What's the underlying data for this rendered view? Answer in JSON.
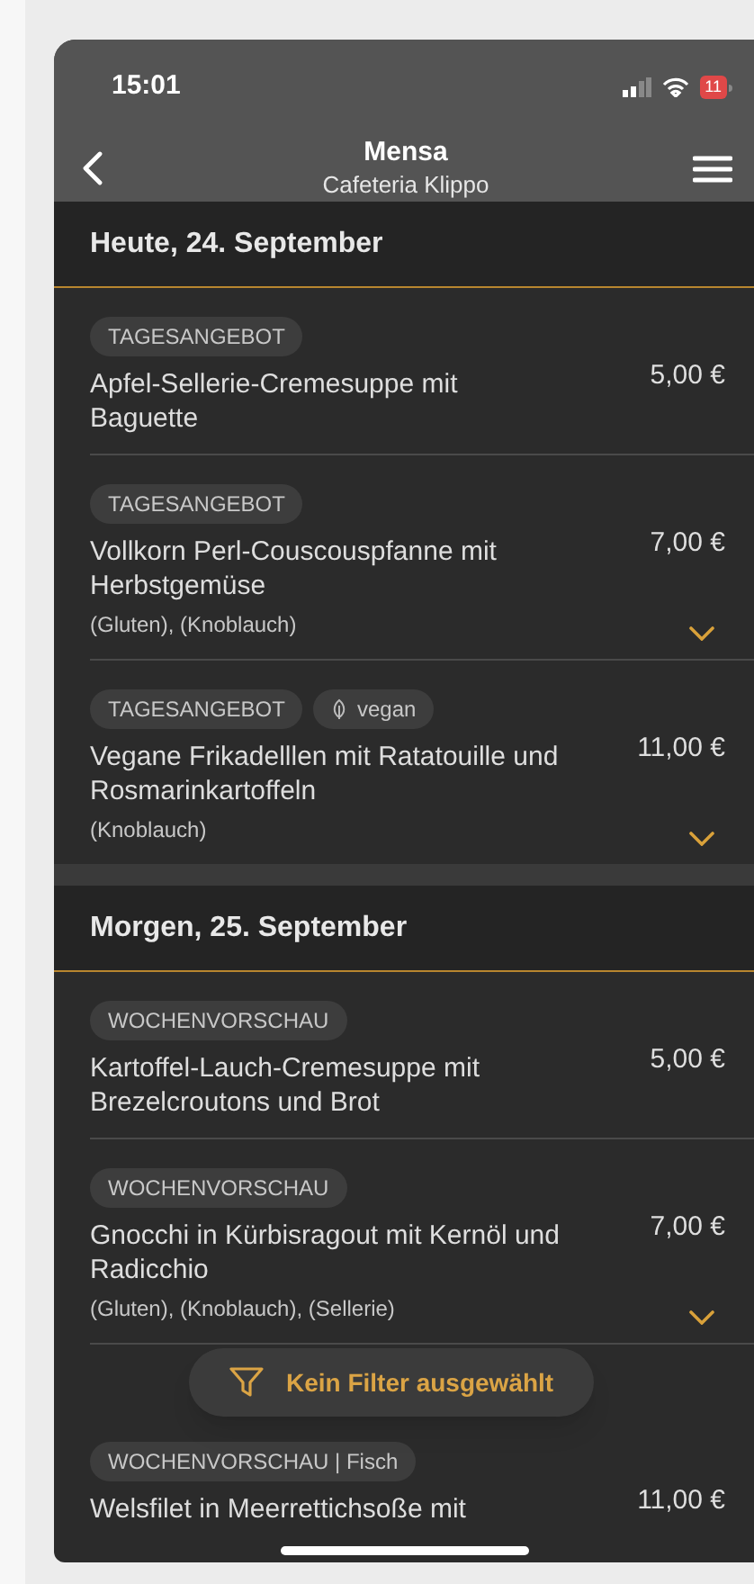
{
  "status_bar": {
    "time": "15:01",
    "battery": "11"
  },
  "nav": {
    "title": "Mensa",
    "subtitle": "Cafeteria Klippo"
  },
  "sections": [
    {
      "title": "Heute, 24. September",
      "items": [
        {
          "tags": [
            {
              "label": "TAGESANGEBOT",
              "kind": "plain"
            }
          ],
          "name": "Apfel-Sellerie-Cremesuppe mit Baguette",
          "price": "5,00 €",
          "expandable": false
        },
        {
          "tags": [
            {
              "label": "TAGESANGEBOT",
              "kind": "plain"
            }
          ],
          "name": "Vollkorn Perl-Couscouspfanne mit Herbstgemüse",
          "allergens": "(Gluten), (Knoblauch)",
          "price": "7,00 €",
          "expandable": true
        },
        {
          "tags": [
            {
              "label": "TAGESANGEBOT",
              "kind": "plain"
            },
            {
              "label": "vegan",
              "kind": "vegan"
            }
          ],
          "name": "Vegane Frikadelllen mit Ratatouille und Rosmarinkartoffeln",
          "allergens": "(Knoblauch)",
          "price": "11,00 €",
          "expandable": true
        }
      ]
    },
    {
      "title": "Morgen, 25. September",
      "items": [
        {
          "tags": [
            {
              "label": "WOCHENVORSCHAU",
              "kind": "plain"
            }
          ],
          "name": "Kartoffel-Lauch-Cremesuppe mit Brezelcroutons und Brot",
          "price": "5,00 €",
          "expandable": false
        },
        {
          "tags": [
            {
              "label": "WOCHENVORSCHAU",
              "kind": "plain"
            }
          ],
          "name": "Gnocchi in Kürbisragout mit Kernöl und Radicchio",
          "allergens": "(Gluten), (Knoblauch), (Sellerie)",
          "price": "7,00 €",
          "expandable": true
        },
        {
          "tags": [
            {
              "label": "WOCHENVORSCHAU | Fisch",
              "kind": "plain"
            }
          ],
          "name": "Welsfilet in Meerrettichsoße mit",
          "price": "11,00 €",
          "expandable": false
        }
      ]
    }
  ],
  "filter_button": {
    "label": "Kein Filter ausgewählt"
  }
}
